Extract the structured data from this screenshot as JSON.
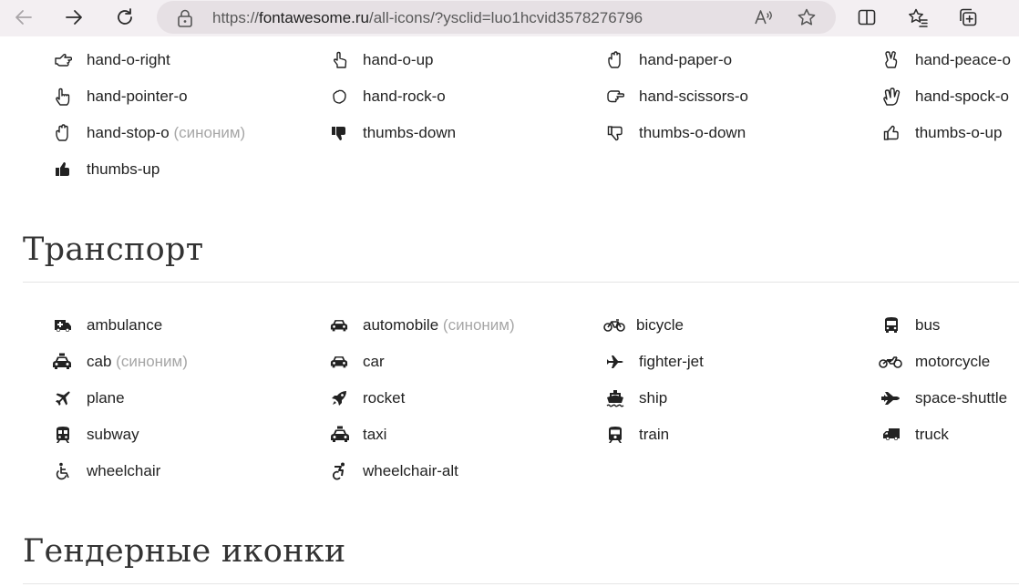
{
  "browser": {
    "url_prefix": "https://",
    "url_host": "fontawesome.ru",
    "url_path": "/all-icons/?ysclid=luo1hcvid3578276796"
  },
  "hands": {
    "items": [
      {
        "name": "hand-o-right",
        "alias": "",
        "icon": "hand-o-right-icon"
      },
      {
        "name": "hand-o-up",
        "alias": "",
        "icon": "hand-o-up-icon"
      },
      {
        "name": "hand-paper-o",
        "alias": "",
        "icon": "hand-paper-o-icon"
      },
      {
        "name": "hand-peace-o",
        "alias": "",
        "icon": "hand-peace-o-icon"
      },
      {
        "name": "hand-pointer-o",
        "alias": "",
        "icon": "hand-pointer-o-icon"
      },
      {
        "name": "hand-rock-o",
        "alias": "",
        "icon": "hand-rock-o-icon"
      },
      {
        "name": "hand-scissors-o",
        "alias": "",
        "icon": "hand-scissors-o-icon"
      },
      {
        "name": "hand-spock-o",
        "alias": "",
        "icon": "hand-spock-o-icon"
      },
      {
        "name": "hand-stop-o",
        "alias": "(синоним)",
        "icon": "hand-stop-o-icon"
      },
      {
        "name": "thumbs-down",
        "alias": "",
        "icon": "thumbs-down-icon"
      },
      {
        "name": "thumbs-o-down",
        "alias": "",
        "icon": "thumbs-o-down-icon"
      },
      {
        "name": "thumbs-o-up",
        "alias": "",
        "icon": "thumbs-o-up-icon"
      },
      {
        "name": "thumbs-up",
        "alias": "",
        "icon": "thumbs-up-icon"
      }
    ]
  },
  "transport": {
    "title": "Транспорт",
    "items": [
      {
        "name": "ambulance",
        "alias": "",
        "icon": "ambulance-icon"
      },
      {
        "name": "automobile",
        "alias": "(синоним)",
        "icon": "automobile-icon"
      },
      {
        "name": "bicycle",
        "alias": "",
        "icon": "bicycle-icon"
      },
      {
        "name": "bus",
        "alias": "",
        "icon": "bus-icon"
      },
      {
        "name": "cab",
        "alias": "(синоним)",
        "icon": "cab-icon"
      },
      {
        "name": "car",
        "alias": "",
        "icon": "car-icon"
      },
      {
        "name": "fighter-jet",
        "alias": "",
        "icon": "fighter-jet-icon"
      },
      {
        "name": "motorcycle",
        "alias": "",
        "icon": "motorcycle-icon"
      },
      {
        "name": "plane",
        "alias": "",
        "icon": "plane-icon"
      },
      {
        "name": "rocket",
        "alias": "",
        "icon": "rocket-icon"
      },
      {
        "name": "ship",
        "alias": "",
        "icon": "ship-icon"
      },
      {
        "name": "space-shuttle",
        "alias": "",
        "icon": "space-shuttle-icon"
      },
      {
        "name": "subway",
        "alias": "",
        "icon": "subway-icon"
      },
      {
        "name": "taxi",
        "alias": "",
        "icon": "taxi-icon"
      },
      {
        "name": "train",
        "alias": "",
        "icon": "train-icon"
      },
      {
        "name": "truck",
        "alias": "",
        "icon": "truck-icon"
      },
      {
        "name": "wheelchair",
        "alias": "",
        "icon": "wheelchair-icon"
      },
      {
        "name": "wheelchair-alt",
        "alias": "",
        "icon": "wheelchair-alt-icon"
      }
    ]
  },
  "gender": {
    "title": "Гендерные иконки"
  }
}
